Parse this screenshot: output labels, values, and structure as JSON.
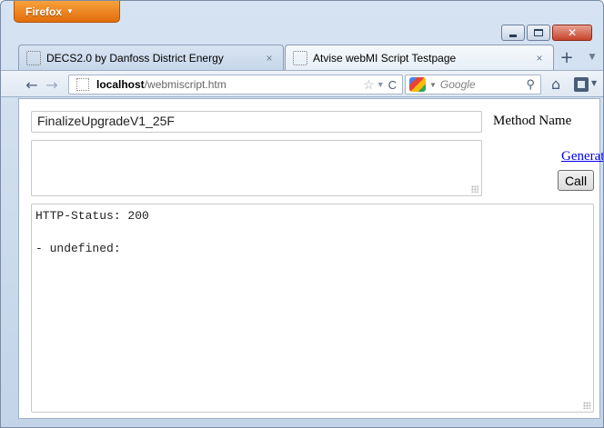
{
  "browser": {
    "menu_button": "Firefox",
    "tabs": [
      {
        "label": "DECS2.0 by Danfoss District Energy",
        "close": "×",
        "active": false
      },
      {
        "label": "Atvise webMI Script Testpage",
        "close": "×",
        "active": true
      }
    ],
    "new_tab": "+",
    "url": {
      "host": "localhost",
      "path": "/webmiscript.htm"
    },
    "search_placeholder": "Google"
  },
  "page": {
    "method_name_value": "FinalizeUpgradeV1_25F",
    "method_name_label": "Method Name",
    "params_value": "",
    "generate_link": "Generate",
    "call_button": "Call",
    "result_lines": [
      "HTTP-Status: 200",
      "",
      "- undefined:"
    ]
  },
  "colors": {
    "firefox_orange": "#e26d0a",
    "link_blue": "#0000ee"
  },
  "icons": [
    "firefox-menu-arrow-icon",
    "minimize-icon",
    "maximize-icon",
    "close-icon",
    "favicon-placeholder-icon",
    "back-arrow-icon",
    "forward-arrow-icon",
    "bookmark-star-icon",
    "reload-icon",
    "google-icon",
    "search-icon",
    "home-icon",
    "bookmarks-icon"
  ]
}
